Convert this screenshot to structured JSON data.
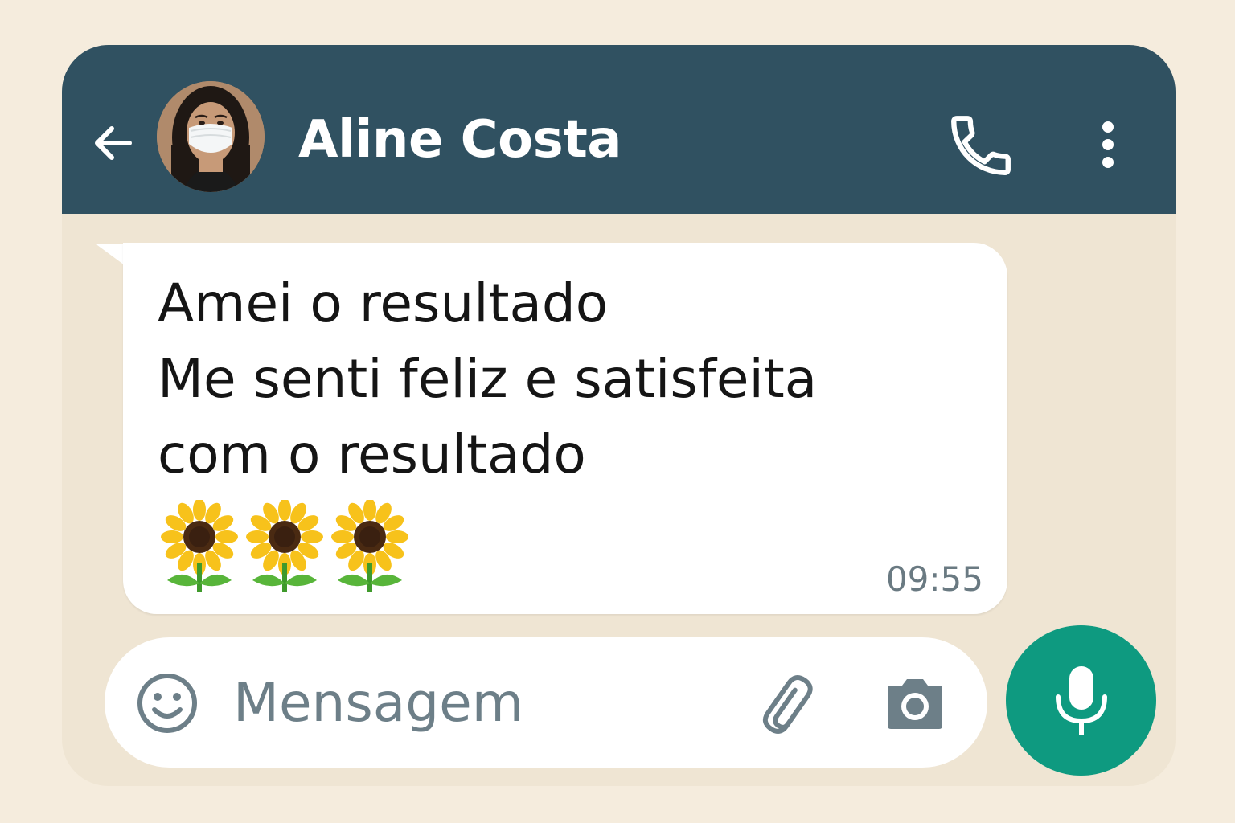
{
  "header": {
    "contact_name": "Aline Costa",
    "back_icon": "arrow-left-icon",
    "call_icon": "phone-icon",
    "menu_icon": "vertical-dots-icon",
    "background_color": "#305161"
  },
  "message": {
    "lines": [
      "Amei o resultado",
      "Me senti feliz e satisfeita",
      "com o resultado"
    ],
    "emojis": [
      "🌻",
      "🌻",
      "🌻"
    ],
    "time": "09:55"
  },
  "composer": {
    "placeholder": "Mensagem",
    "value": "",
    "emoji_icon": "smiley-icon",
    "attach_icon": "paperclip-icon",
    "camera_icon": "camera-icon",
    "mic_icon": "microphone-icon",
    "mic_button_color": "#0e9a80"
  },
  "colors": {
    "page_background": "#f5ecdd",
    "chat_background": "#efe5d3",
    "bubble_background": "#ffffff"
  }
}
